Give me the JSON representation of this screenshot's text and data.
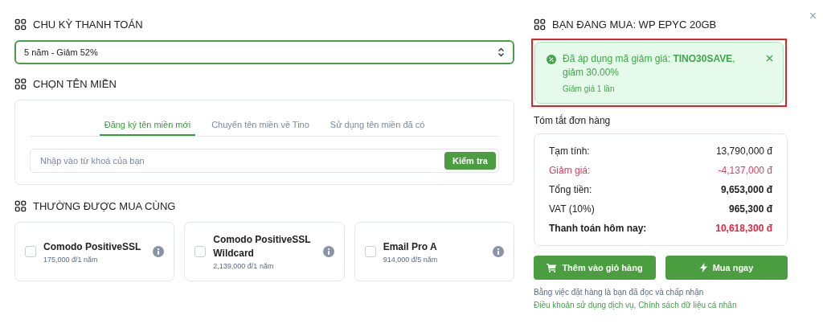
{
  "billing": {
    "title": "CHU KỲ THANH TOÁN",
    "value": "5 năm - Giảm 52%"
  },
  "domain": {
    "title": "CHỌN TÊN MIỀN",
    "tabs": [
      {
        "label": "Đăng ký tên miền mới",
        "selected": true
      },
      {
        "label": "Chuyển tên miền về Tino",
        "selected": false
      },
      {
        "label": "Sử dụng tên miền đã có",
        "selected": false
      }
    ],
    "search": {
      "placeholder": "Nhập vào từ khoá của bạn",
      "button": "Kiểm tra"
    }
  },
  "addons": {
    "title": "THƯỜNG ĐƯỢC MUA CÙNG",
    "items": [
      {
        "name": "Comodo PositiveSSL",
        "price": "175,000 đ/1 năm",
        "checked": false
      },
      {
        "name": "Comodo PositiveSSL Wildcard",
        "price": "2,139,000 đ/1 năm",
        "checked": false
      },
      {
        "name": "Email Pro A",
        "price": "914,000 đ/5 năm",
        "checked": false
      }
    ]
  },
  "order": {
    "title": "BẠN ĐANG MUA: WP EPYC 20GB",
    "coupon": {
      "message": "Đã áp dụng mã giảm giá: **TINO30SAVE**, giảm 30.00%",
      "note": "Giảm giá 1 lần",
      "highlighted": true
    },
    "summary_title": "Tóm tắt đơn hàng",
    "rows": [
      {
        "label": "Tạm tính:",
        "value": "13,790,000 đ",
        "kind": "normal"
      },
      {
        "label": "Giảm giá:",
        "value": "-4,137,000 đ",
        "kind": "discount"
      },
      {
        "label": "Tổng tiền:",
        "value": "9,653,000 đ",
        "kind": "strong"
      },
      {
        "label": "VAT (10%)",
        "value": "965,300 đ",
        "kind": "strong"
      },
      {
        "label": "Thanh toán hôm nay:",
        "value": "10,618,300 đ",
        "kind": "total"
      }
    ],
    "buttons": {
      "cart": "Thêm vào giỏ hàng",
      "buy": "Mua ngay"
    },
    "terms": {
      "text": "Bằng việc đặt hàng là bạn đã đọc và chấp nhận",
      "links": [
        "Điều khoản sử dụng dịch vụ",
        "Chính sách dữ liệu cá nhân"
      ],
      "separator": ","
    }
  },
  "close": "×"
}
